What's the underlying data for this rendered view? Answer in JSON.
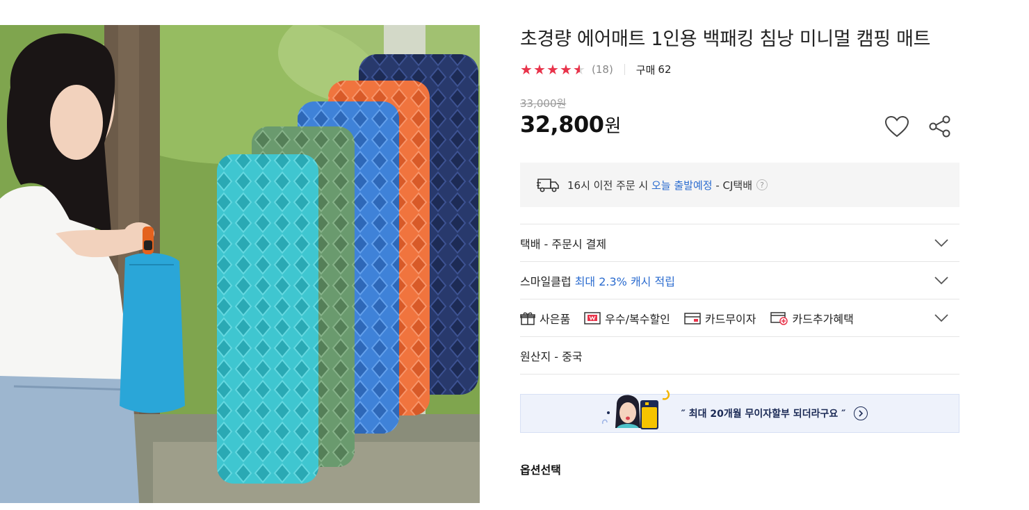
{
  "product": {
    "title": "초경량 에어매트 1인용 백패킹 침낭 미니멀 캠핑 매트",
    "rating": 4.5,
    "review_count": "(18)",
    "purchase_label": "구매",
    "purchase_count": "62",
    "original_price": "33,000원",
    "price": "32,800",
    "price_unit": "원"
  },
  "icons": {
    "wishlist": "heart-icon",
    "share": "share-icon",
    "delivery": "truck-icon",
    "help": "question-icon",
    "expand": "chevron-down-icon"
  },
  "delivery": {
    "prefix": "16시 이전 주문 시",
    "highlight": "오늘 출발예정",
    "suffix": "- CJ택배",
    "help_glyph": "?"
  },
  "rows": {
    "shipping": "택배 - 주문시 결제",
    "smileclub_prefix": "스마일클럽",
    "smileclub_highlight": "최대 2.3% 캐시 적립",
    "benefits": [
      "사은품",
      "우수/복수할인",
      "카드무이자",
      "카드추가혜택"
    ],
    "origin": "원산지 - 중국"
  },
  "banner": {
    "text": "″ 최대 20개월 무이자할부 되더라구요 ″"
  },
  "options": {
    "label": "옵션선택"
  },
  "colors": {
    "accent_blue": "#2a6bcf",
    "star_red": "#e8334a",
    "banner_bg": "#eef2fb"
  }
}
